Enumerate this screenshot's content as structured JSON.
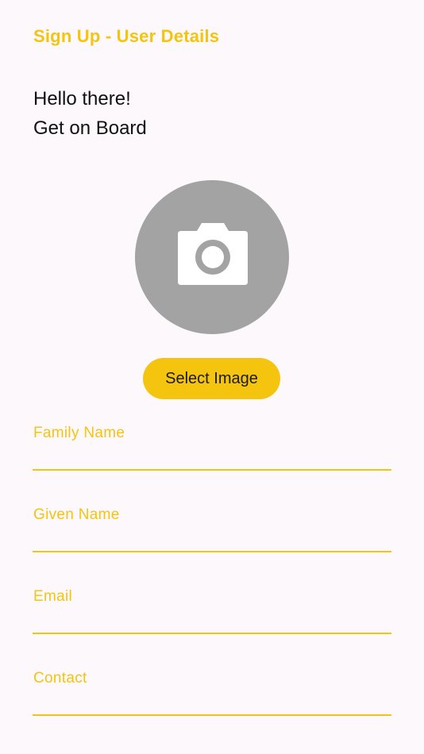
{
  "header": {
    "title": "Sign Up - User Details"
  },
  "greeting": {
    "line1": "Hello there!",
    "line2": "Get on Board"
  },
  "avatar": {
    "icon": "camera-icon",
    "select_label": "Select Image"
  },
  "form": {
    "family_name": {
      "label": "Family Name",
      "value": ""
    },
    "given_name": {
      "label": "Given Name",
      "value": ""
    },
    "email": {
      "label": "Email",
      "value": ""
    },
    "contact": {
      "label": "Contact",
      "value": ""
    }
  },
  "colors": {
    "accent": "#f5c40f",
    "background": "#fcf8fb",
    "avatar_bg": "#a3a3a3",
    "text": "#111111"
  }
}
